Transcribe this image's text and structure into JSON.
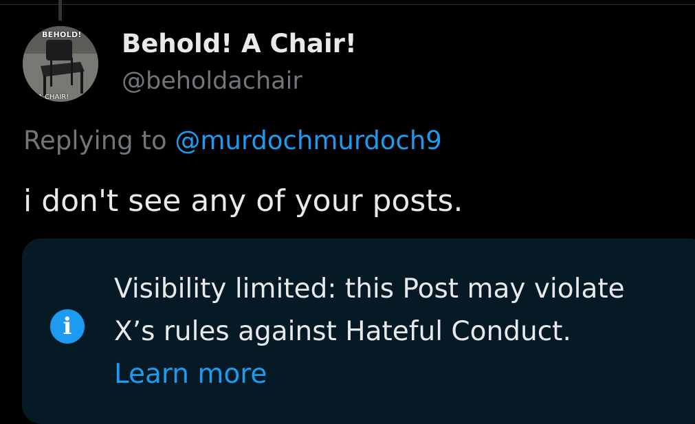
{
  "post": {
    "author": {
      "display_name": "Behold! A Chair!",
      "handle": "@beholdachair",
      "avatar": {
        "caption_top": "BEHOLD!",
        "caption_bottom": "A CHAIR!"
      }
    },
    "replying_prefix": "Replying to ",
    "replying_to": "@murdochmurdoch9",
    "text": "i don't see any of your posts."
  },
  "notice": {
    "icon": "info-icon",
    "line1": "Visibility limited: this Post may violate",
    "line2": "X’s rules against Hateful Conduct.",
    "learn_more": "Learn more"
  },
  "colors": {
    "background": "#000000",
    "text_primary": "#e7e9ea",
    "text_secondary": "#71767b",
    "accent": "#1d9bf0",
    "notice_background": "#061a26"
  }
}
